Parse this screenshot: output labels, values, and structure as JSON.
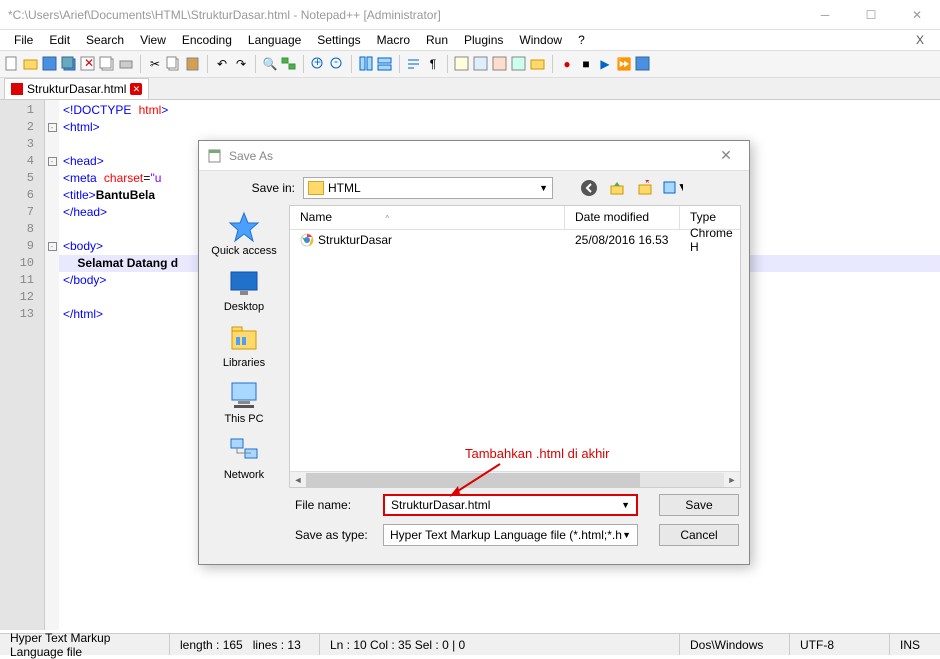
{
  "window": {
    "title": "*C:\\Users\\Arief\\Documents\\HTML\\StrukturDasar.html - Notepad++ [Administrator]"
  },
  "menu": [
    "File",
    "Edit",
    "Search",
    "View",
    "Encoding",
    "Language",
    "Settings",
    "Macro",
    "Run",
    "Plugins",
    "Window",
    "?"
  ],
  "tab": {
    "label": "StrukturDasar.html"
  },
  "code": {
    "lines": [
      "<!DOCTYPE html>",
      "<html>",
      "",
      "<head>",
      "<meta charset=\"u",
      "<title>BantuBela",
      "</head>",
      "",
      "<body>",
      "Selamat Datang d",
      "</body>",
      "",
      "</html>"
    ]
  },
  "status": {
    "type": "Hyper Text Markup Language file",
    "length": "length : 165",
    "lines": "lines : 13",
    "pos": "Ln : 10    Col : 35    Sel : 0 | 0",
    "eol": "Dos\\Windows",
    "enc": "UTF-8",
    "ins": "INS"
  },
  "dialog": {
    "title": "Save As",
    "savein_label": "Save in:",
    "savein_value": "HTML",
    "columns": {
      "name": "Name",
      "date": "Date modified",
      "type": "Type"
    },
    "file": {
      "name": "StrukturDasar",
      "date": "25/08/2016 16.53",
      "type": "Chrome H"
    },
    "places": [
      "Quick access",
      "Desktop",
      "Libraries",
      "This PC",
      "Network"
    ],
    "filename_label": "File name:",
    "filename_value": "StrukturDasar.html",
    "savetype_label": "Save as type:",
    "savetype_value": "Hyper Text Markup Language file (*.html;*.htm;",
    "save_btn": "Save",
    "cancel_btn": "Cancel"
  },
  "annotation": "Tambahkan .html di akhir"
}
